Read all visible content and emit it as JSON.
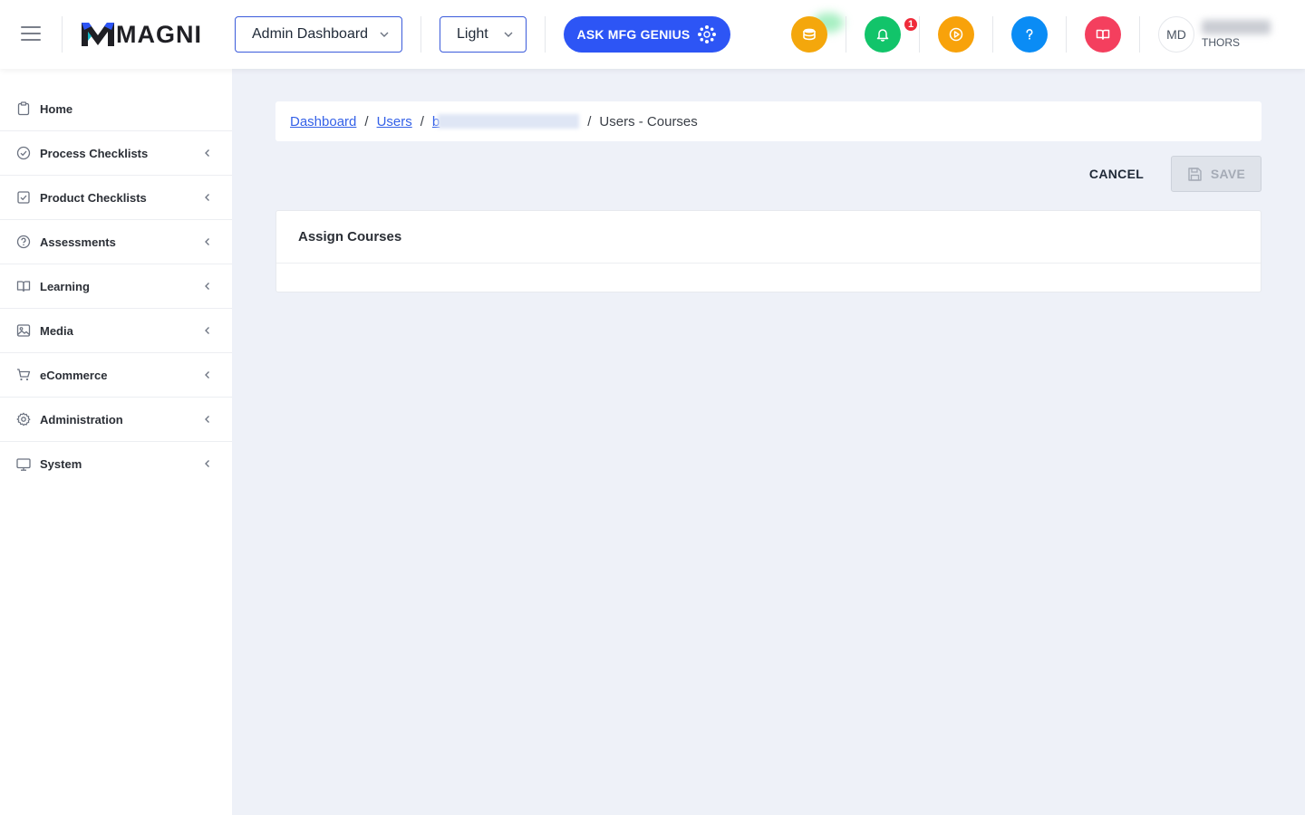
{
  "header": {
    "logo_text": "MAGNI",
    "dashboard_select": "Admin Dashboard",
    "theme_select": "Light",
    "ask_button": "ASK MFG GENIUS",
    "notification_count": "1",
    "user_initials": "MD",
    "user_org": "THORS"
  },
  "sidebar": {
    "items": [
      {
        "label": "Home",
        "icon": "clipboard-icon"
      },
      {
        "label": "Process Checklists",
        "icon": "check-circle-icon"
      },
      {
        "label": "Product Checklists",
        "icon": "check-square-icon"
      },
      {
        "label": "Assessments",
        "icon": "help-circle-icon"
      },
      {
        "label": "Learning",
        "icon": "book-open-icon"
      },
      {
        "label": "Media",
        "icon": "image-icon"
      },
      {
        "label": "eCommerce",
        "icon": "cart-icon"
      },
      {
        "label": "Administration",
        "icon": "gear-icon"
      },
      {
        "label": "System",
        "icon": "monitor-icon"
      }
    ]
  },
  "breadcrumb": {
    "items": [
      "Dashboard",
      "Users",
      "b"
    ],
    "current": "Users - Courses"
  },
  "actions": {
    "cancel": "CANCEL",
    "save": "SAVE"
  },
  "courses": {
    "title": "Assign Courses"
  },
  "colors": {
    "primary": "#2d55f5",
    "coins": "#f4a70c",
    "notifications": "#12c46a",
    "play": "#f8a20a",
    "help": "#0a8cf5",
    "book": "#f43f5e",
    "badge": "#ef2b3a"
  }
}
